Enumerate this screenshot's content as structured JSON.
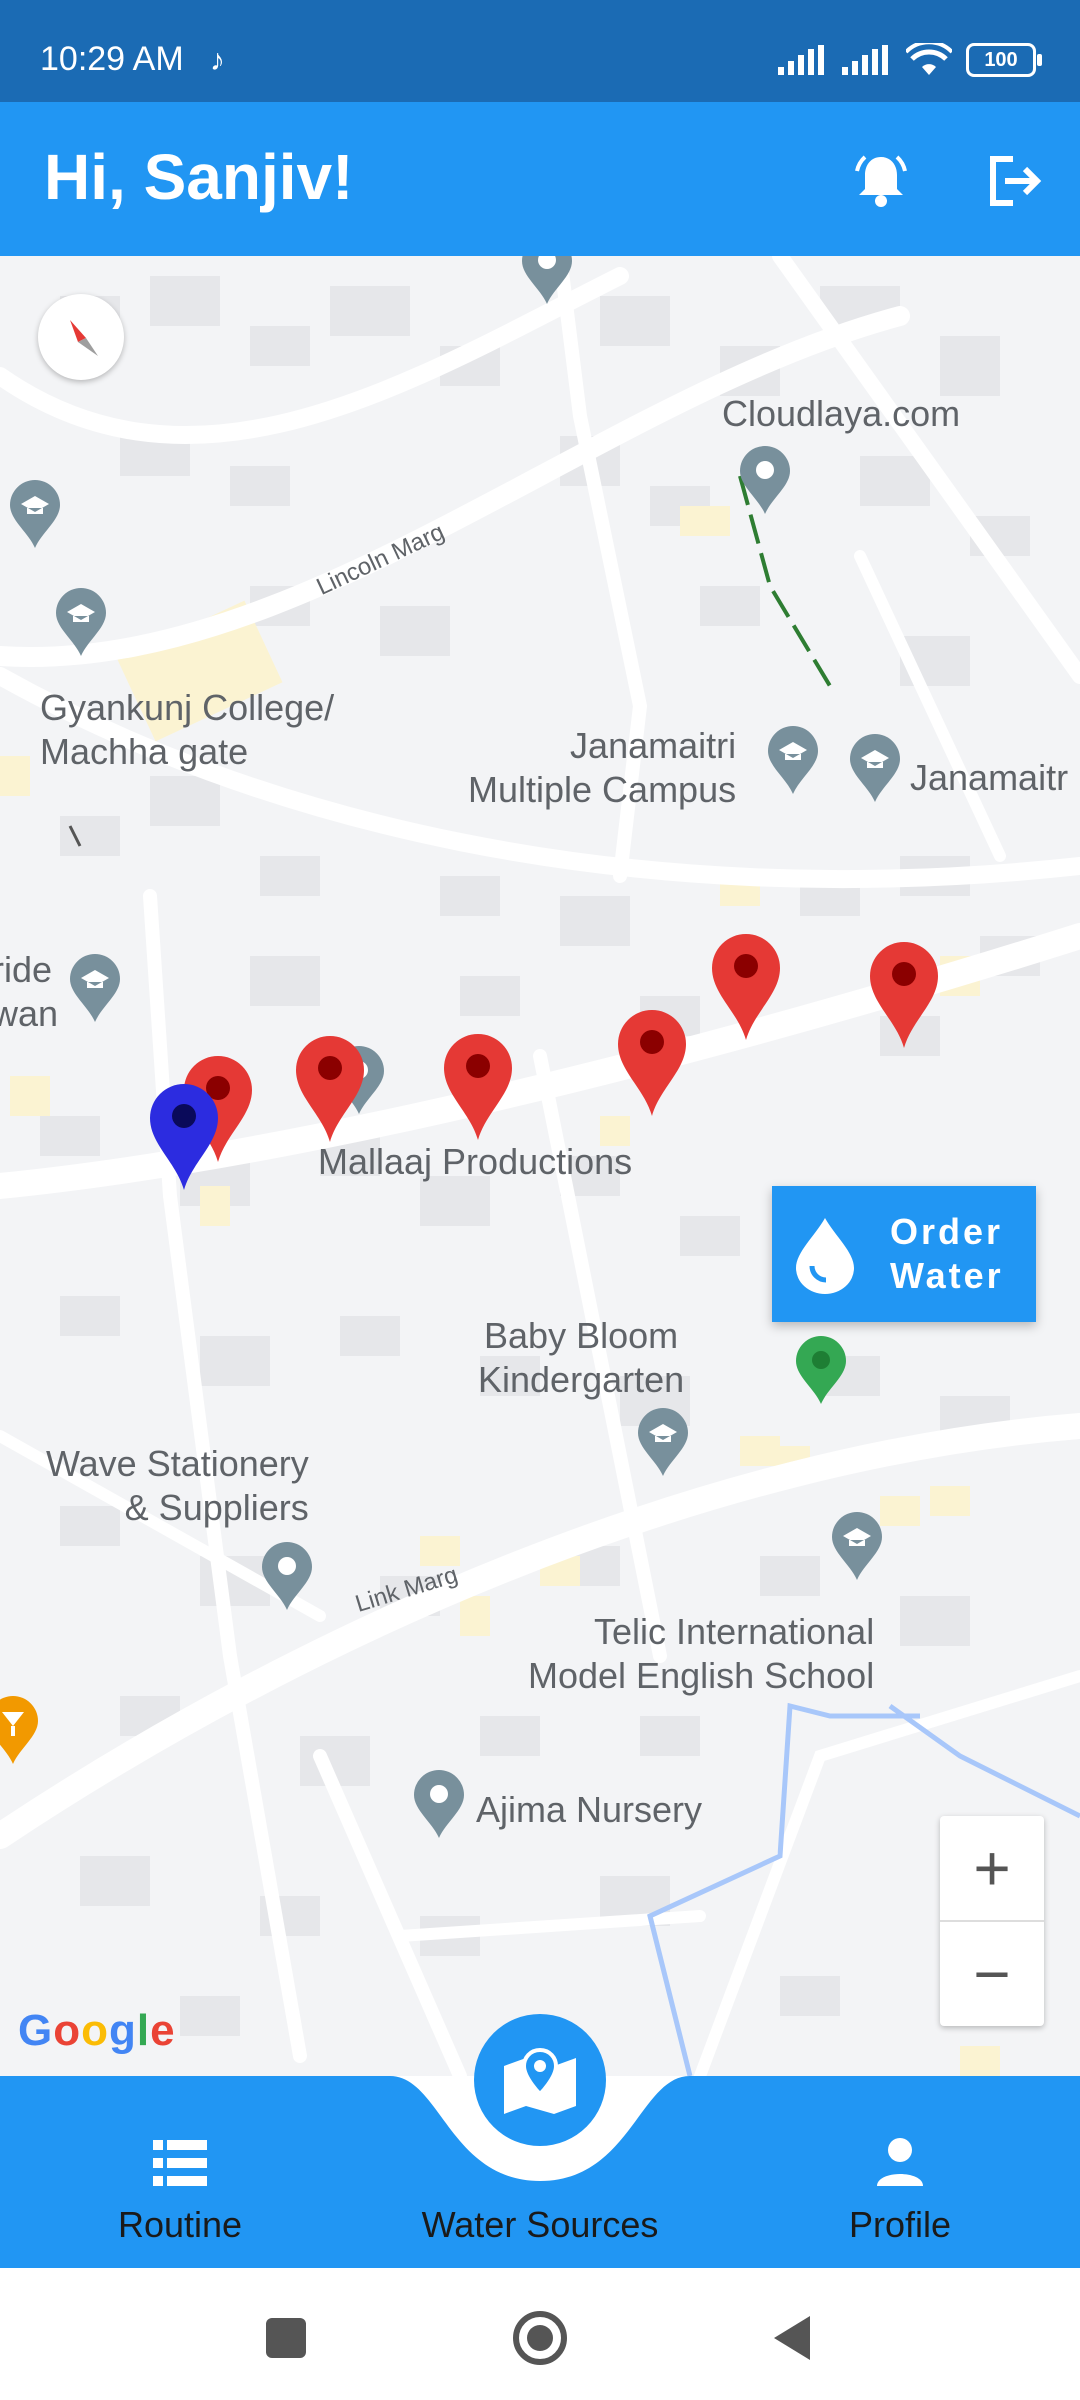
{
  "status_bar": {
    "time": "10:29 AM",
    "battery": "100"
  },
  "app_bar": {
    "title": "Hi, Sanjiv!"
  },
  "map": {
    "places": [
      {
        "name": "Cloudlaya.com"
      },
      {
        "name": "Gyankunj College/\nMachha gate"
      },
      {
        "name": "Janamaitri\nMultiple Campus"
      },
      {
        "name": "Janamaitr"
      },
      {
        "name": "ride\nwan"
      },
      {
        "name": "Mallaaj Productions"
      },
      {
        "name": "Baby Bloom\nKindergarten"
      },
      {
        "name": "Wave Stationery\n& Suppliers"
      },
      {
        "name": "Telic International\nModel English School"
      },
      {
        "name": "Ajima Nursery"
      }
    ],
    "streets": [
      "Lincoln Marg",
      "Link Marg"
    ],
    "attribution": "Google"
  },
  "order_button": {
    "line1": "Order",
    "line2": "Water"
  },
  "zoom": {
    "plus": "+",
    "minus": "−"
  },
  "bottom_nav": {
    "items": [
      {
        "label": "Routine",
        "icon": "list-icon"
      },
      {
        "label": "Water Sources",
        "icon": "map-icon"
      },
      {
        "label": "Profile",
        "icon": "person-icon"
      }
    ]
  },
  "colors": {
    "primary": "#2196f3",
    "status": "#1b6bb4",
    "pin_red": "#e53935",
    "pin_blue": "#2c2ce0",
    "pin_green": "#34a853"
  }
}
